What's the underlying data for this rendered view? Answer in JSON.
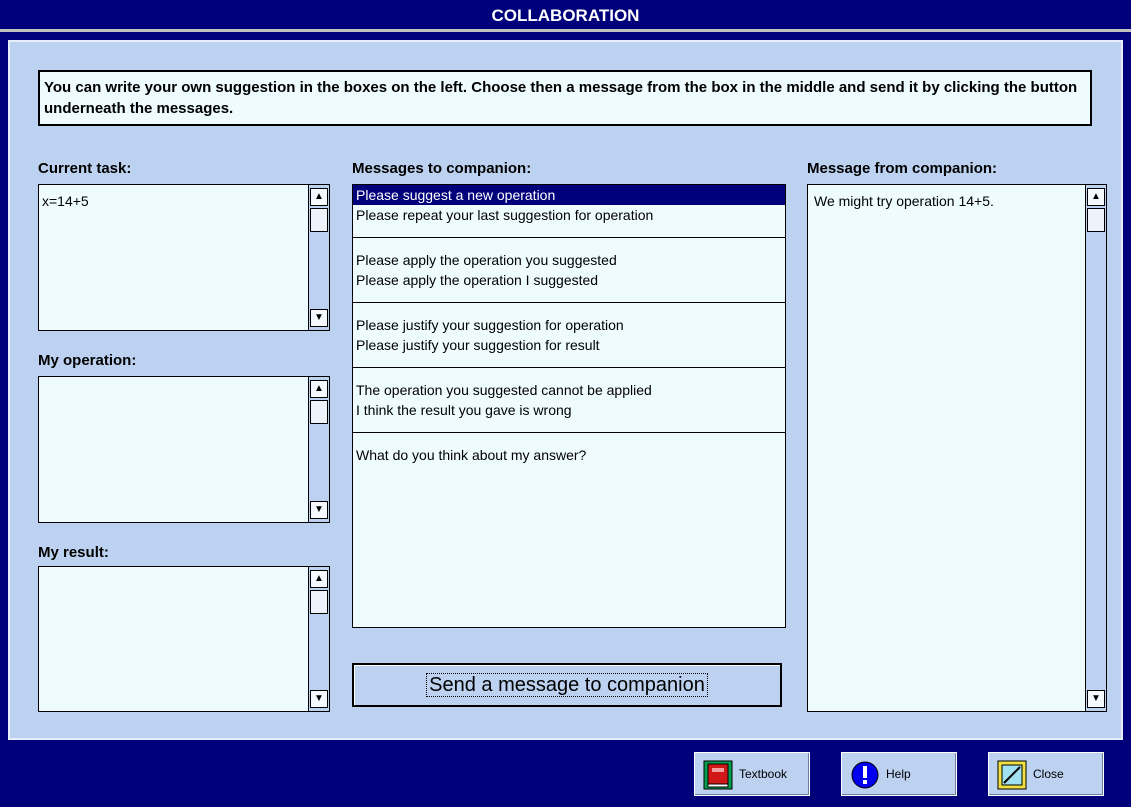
{
  "window": {
    "title": "COLLABORATION"
  },
  "instructions": "You can write your own suggestion in the boxes on the left. Choose then a message from the box in the middle and send it by clicking the button underneath the messages.",
  "left": {
    "current_task": {
      "label": "Current task:",
      "value": "x=14+5"
    },
    "my_operation": {
      "label": "My operation:",
      "value": ""
    },
    "my_result": {
      "label": "My result:",
      "value": ""
    }
  },
  "messages": {
    "label": "Messages to companion:",
    "groups": [
      [
        "Please suggest a new operation",
        "Please repeat your last suggestion for operation"
      ],
      [
        "Please apply the operation you suggested",
        "Please apply the operation I suggested"
      ],
      [
        "Please justify your suggestion for operation",
        "Please justify your suggestion for result"
      ],
      [
        "The operation you suggested cannot be applied",
        "I think the result you gave is wrong"
      ],
      [
        "What do you think about my answer?"
      ]
    ],
    "selected": "Please suggest a new operation",
    "send_label": "Send a message to companion"
  },
  "companion": {
    "label": "Message from companion:",
    "value": "We might try operation 14+5."
  },
  "footer": {
    "textbook_label": "Textbook",
    "help_label": "Help",
    "close_label": "Close"
  },
  "icons": {
    "scroll_up": "arrow-up-icon",
    "scroll_down": "arrow-down-icon",
    "textbook": "book-icon",
    "help": "info-icon",
    "close": "close-icon"
  },
  "colors": {
    "title_bg": "#00007b",
    "panel_bg": "#bcd2f0",
    "field_bg": "#eefcff",
    "selection": "#00007b"
  }
}
